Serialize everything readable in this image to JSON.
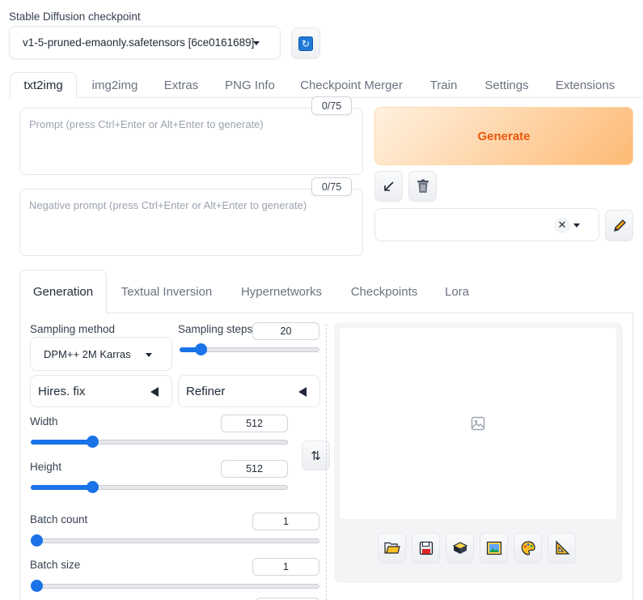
{
  "checkpoint": {
    "label": "Stable Diffusion checkpoint",
    "value": "v1-5-pruned-emaonly.safetensors [6ce0161689]"
  },
  "main_tabs": [
    "txt2img",
    "img2img",
    "Extras",
    "PNG Info",
    "Checkpoint Merger",
    "Train",
    "Settings",
    "Extensions"
  ],
  "active_main_tab": "txt2img",
  "prompt": {
    "placeholder": "Prompt (press Ctrl+Enter or Alt+Enter to generate)",
    "counter": "0/75"
  },
  "negative_prompt": {
    "placeholder": "Negative prompt (press Ctrl+Enter or Alt+Enter to generate)",
    "counter": "0/75"
  },
  "generate_label": "Generate",
  "sub_tabs": [
    "Generation",
    "Textual Inversion",
    "Hypernetworks",
    "Checkpoints",
    "Lora"
  ],
  "active_sub_tab": "Generation",
  "sampling": {
    "method_label": "Sampling method",
    "method_value": "DPM++ 2M Karras",
    "steps_label": "Sampling steps",
    "steps_value": "20"
  },
  "accordions": {
    "hires": "Hires. fix",
    "refiner": "Refiner"
  },
  "width": {
    "label": "Width",
    "value": "512"
  },
  "height": {
    "label": "Height",
    "value": "512"
  },
  "batch_count": {
    "label": "Batch count",
    "value": "1"
  },
  "batch_size": {
    "label": "Batch size",
    "value": "1"
  },
  "slider_levels": {
    "sampling_steps": 0.15,
    "width": 0.24,
    "height": 0.24,
    "batch_count": 0.0,
    "batch_size": 0.0
  },
  "icons": {
    "refresh": "refresh-icon",
    "read_params": "arrow-diagonal-icon",
    "trash": "trash-icon",
    "edit_styles": "pencil-icon",
    "swap": "swap-vertical-icon",
    "image_placeholder": "image-icon",
    "folder": "folder-icon",
    "save": "floppy-disk-icon",
    "zip": "zip-icon",
    "send_img2img": "picture-icon",
    "send_inpaint": "palette-icon",
    "send_extras": "triangle-ruler-icon"
  },
  "colors": {
    "accent": "#1a73e8",
    "generate_text": "#ea580c",
    "generate_bg_from": "#fff1e0",
    "generate_bg_to": "#fdba74"
  }
}
